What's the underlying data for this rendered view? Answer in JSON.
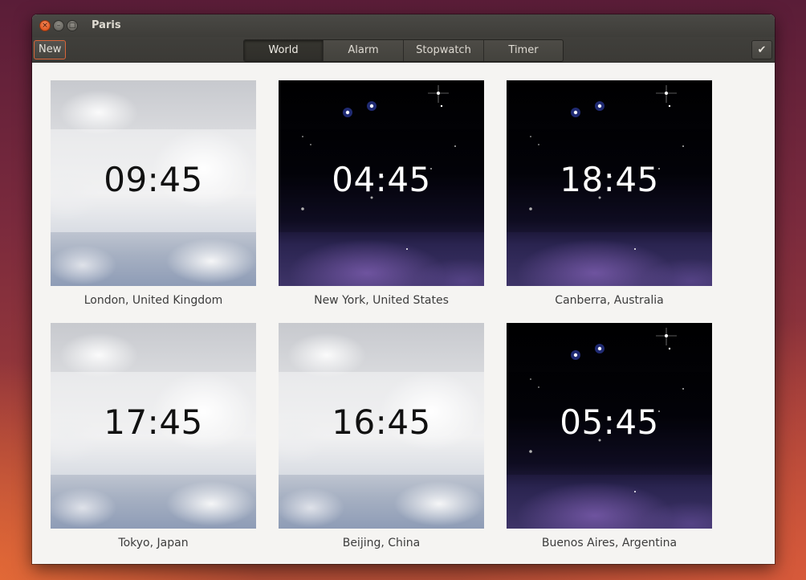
{
  "window": {
    "title": "Paris",
    "controls": {
      "close": "×",
      "minimize": "–",
      "maximize": "□"
    }
  },
  "toolbar": {
    "new_label": "New",
    "tabs": [
      {
        "label": "World",
        "active": true
      },
      {
        "label": "Alarm",
        "active": false
      },
      {
        "label": "Stopwatch",
        "active": false
      },
      {
        "label": "Timer",
        "active": false
      }
    ],
    "select_icon": "checkmark-icon"
  },
  "clocks": [
    {
      "time": "09:45",
      "location": "London, United Kingdom",
      "theme": "day"
    },
    {
      "time": "04:45",
      "location": "New York, United States",
      "theme": "night"
    },
    {
      "time": "18:45",
      "location": "Canberra, Australia",
      "theme": "night"
    },
    {
      "time": "17:45",
      "location": "Tokyo, Japan",
      "theme": "day"
    },
    {
      "time": "16:45",
      "location": "Beijing, China",
      "theme": "day"
    },
    {
      "time": "05:45",
      "location": "Buenos Aires, Argentina",
      "theme": "night"
    }
  ],
  "colors": {
    "accent": "#e15a23",
    "titlebar": "#3e3d39",
    "content_background": "#f5f4f2"
  }
}
